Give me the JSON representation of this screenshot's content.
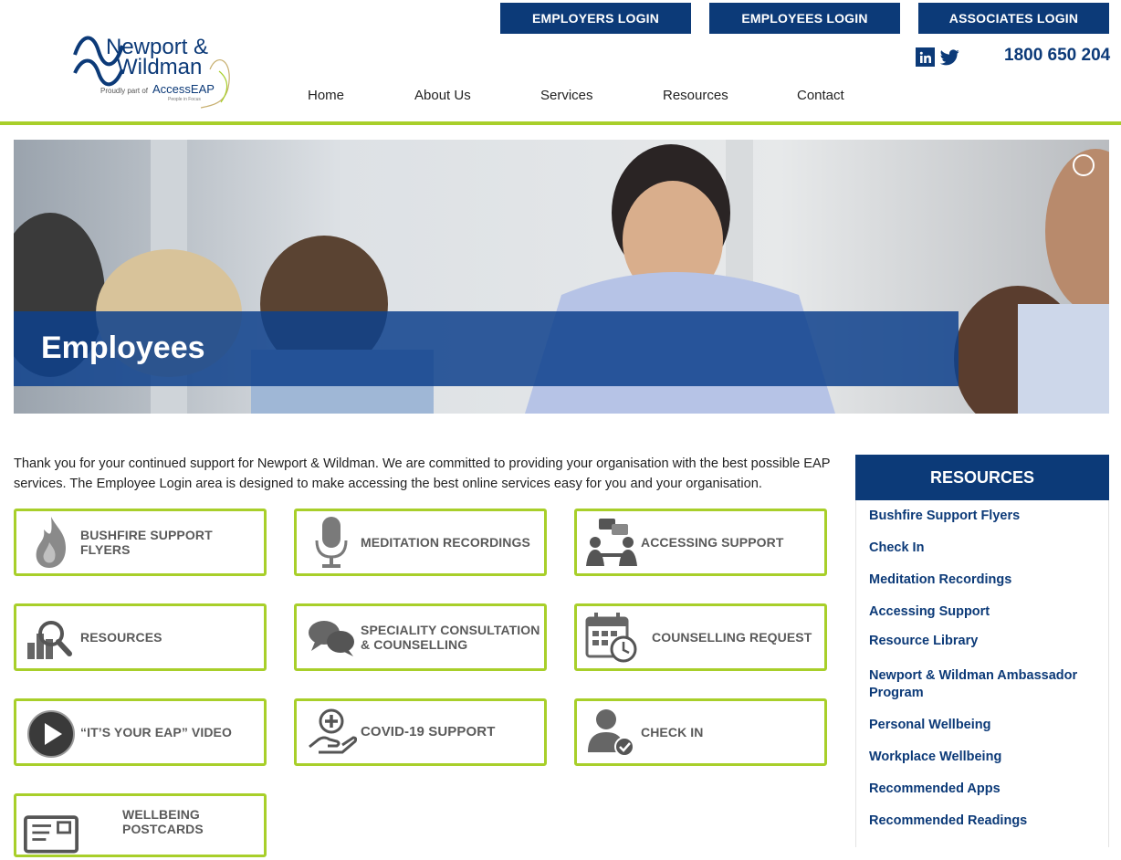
{
  "header": {
    "logins": [
      "EMPLOYERS LOGIN",
      "EMPLOYEES LOGIN",
      "ASSOCIATES LOGIN"
    ],
    "phone": "1800 650 204",
    "nav": [
      "Home",
      "About Us",
      "Services",
      "Resources",
      "Contact"
    ],
    "logo": {
      "line1": "Newport &",
      "line2": "Wildman",
      "tagline": "Proudly part of",
      "brand": "AccessEAP",
      "sub": "People in Focus"
    }
  },
  "hero": {
    "title": "Employees"
  },
  "intro": "Thank you for your continued support for Newport & Wildman. We are committed to providing your organisation with the best possible EAP services. The Employee Login area is designed to make accessing the best online services easy for you and your organisation.",
  "tiles": [
    {
      "label": "BUSHFIRE SUPPORT FLYERS",
      "icon": "flame-icon"
    },
    {
      "label": "MEDITATION RECORDINGS",
      "icon": "microphone-icon"
    },
    {
      "label": "ACCESSING SUPPORT",
      "icon": "support-people-icon"
    },
    {
      "label": "RESOURCES",
      "icon": "magnifier-chart-icon"
    },
    {
      "label": "SPECIALITY CONSULTATION & COUNSELLING",
      "icon": "chat-bubbles-icon"
    },
    {
      "label": "COUNSELLING REQUEST",
      "icon": "calendar-clock-icon"
    },
    {
      "label": "“IT’S YOUR EAP” VIDEO",
      "icon": "play-icon"
    },
    {
      "label": "COVID-19 SUPPORT",
      "icon": "medical-hand-icon"
    },
    {
      "label": "CHECK IN",
      "icon": "user-check-icon"
    },
    {
      "label": "WELLBEING POSTCARDS",
      "icon": "postcard-icon"
    }
  ],
  "sidebar": {
    "title": "RESOURCES",
    "links": [
      "Bushfire Support Flyers",
      "Check In",
      "Meditation Recordings",
      "Accessing Support",
      "Resource Library",
      "Newport & Wildman Ambassador Program",
      "Personal Wellbeing",
      "Workplace Wellbeing",
      "Recommended Apps",
      "Recommended Readings"
    ]
  },
  "colors": {
    "navy": "#0c3a78",
    "lime": "#a8cf2a",
    "hero_band": "#0e418c"
  }
}
